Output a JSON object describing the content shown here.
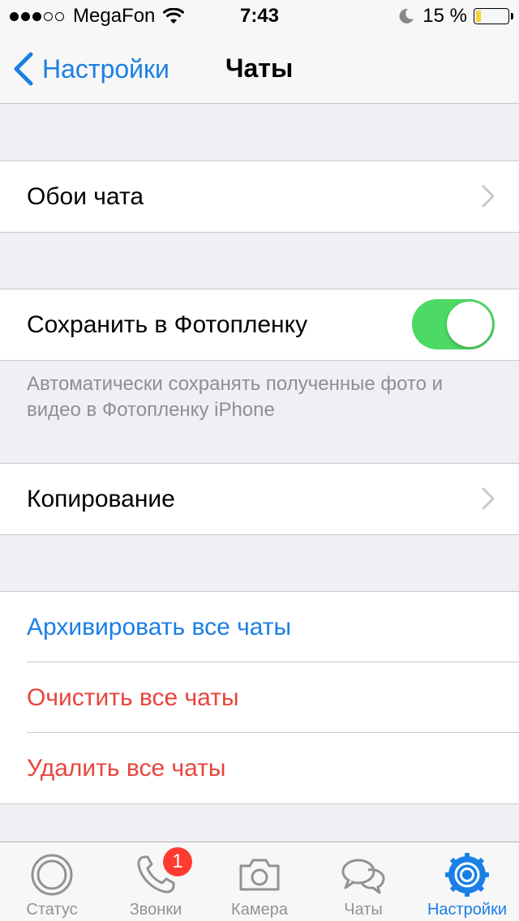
{
  "status_bar": {
    "signal_filled": 3,
    "signal_total": 5,
    "carrier": "MegaFon",
    "time": "7:43",
    "battery_percent": "15 %",
    "battery_level": 0.15
  },
  "nav": {
    "back_label": "Настройки",
    "title": "Чаты"
  },
  "settings": {
    "wallpaper_label": "Обои чата",
    "save_to_camera_roll_label": "Сохранить в Фотопленку",
    "save_to_camera_roll_on": true,
    "save_footnote": "Автоматически сохранять полученные фото и видео в Фотопленку iPhone",
    "backup_label": "Копирование",
    "archive_all_label": "Архивировать все чаты",
    "clear_all_label": "Очистить все чаты",
    "delete_all_label": "Удалить все чаты"
  },
  "tabbar": {
    "tabs": [
      {
        "label": "Статус",
        "icon": "status-icon",
        "active": false
      },
      {
        "label": "Звонки",
        "icon": "phone-icon",
        "active": false,
        "badge": "1"
      },
      {
        "label": "Камера",
        "icon": "camera-icon",
        "active": false
      },
      {
        "label": "Чаты",
        "icon": "chats-icon",
        "active": false
      },
      {
        "label": "Настройки",
        "icon": "settings-gear-icon",
        "active": true
      }
    ]
  },
  "colors": {
    "accent_blue": "#1a7fe6",
    "destructive_red": "#e8453c",
    "toggle_green": "#4cd964",
    "battery_yellow": "#f5d23a",
    "badge_red": "#ff3b30"
  }
}
